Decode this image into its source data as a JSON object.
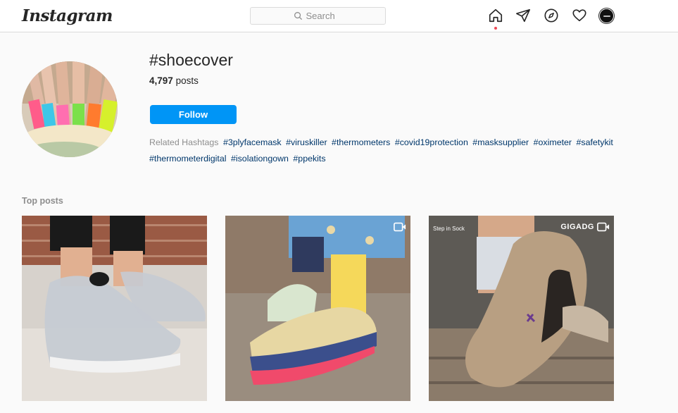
{
  "nav": {
    "logo": "Instagram",
    "search_placeholder": "Search",
    "icons": [
      "home-icon",
      "direct-icon",
      "explore-icon",
      "activity-heart-icon",
      "profile-avatar"
    ]
  },
  "header": {
    "hashtag": "#shoecover",
    "post_count": "4,797",
    "posts_word": "posts",
    "follow_label": "Follow",
    "related_label": "Related Hashtags",
    "related": [
      "#3plyfacemask",
      "#viruskiller",
      "#thermometers",
      "#covid19protection",
      "#masksupplier",
      "#oximeter",
      "#safetykit",
      "#thermometerdigital",
      "#isolationgown",
      "#ppekits"
    ]
  },
  "top_posts": {
    "title": "Top posts",
    "posts": [
      {
        "type": "image",
        "caption": ""
      },
      {
        "type": "video",
        "caption": ""
      },
      {
        "type": "video",
        "caption": "Step in Sock",
        "brand": "GIGADG"
      }
    ]
  },
  "colors": {
    "accent": "#0095f6",
    "hashtag_link": "#00376b",
    "notification_dot": "#ed4956"
  }
}
